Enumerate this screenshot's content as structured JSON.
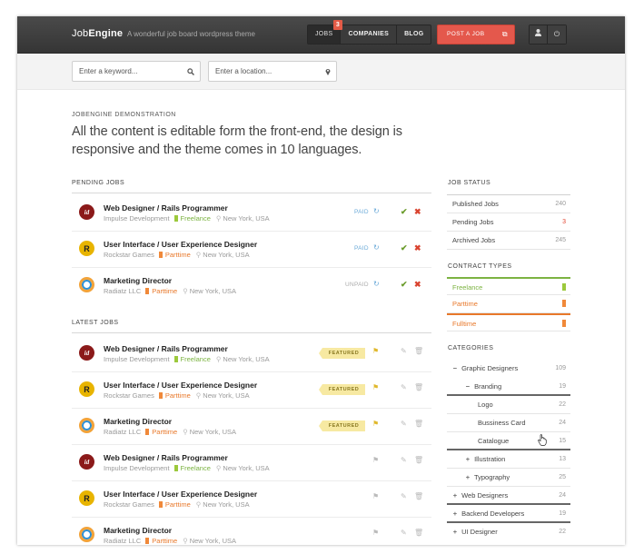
{
  "header": {
    "logo_light": "Job",
    "logo_bold": "Engine",
    "tagline": "A wonderful job board wordpress theme",
    "nav": [
      {
        "label": "JOBS",
        "badge": "3"
      },
      {
        "label": "COMPANIES"
      },
      {
        "label": "BLOG"
      }
    ],
    "post_job_label": "POST A JOB",
    "icons": [
      "user-icon",
      "power-icon"
    ]
  },
  "search": {
    "keyword_placeholder": "Enter a keyword...",
    "location_placeholder": "Enter a location..."
  },
  "intro": {
    "label": "JOBENGINE DEMONSTRATION",
    "headline": "All the content is editable form the front-end, the design is responsive and the theme comes in 10 languages."
  },
  "pending": {
    "title": "PENDING JOBS",
    "jobs": [
      {
        "title": "Web Designer / Rails Programmer",
        "company": "Impulse Development",
        "type": "Freelance",
        "location": "New York, USA",
        "status": "PAID"
      },
      {
        "title": "User Interface / User Experience Designer",
        "company": "Rockstar Games",
        "type": "Parttime",
        "location": "New York, USA",
        "status": "PAID"
      },
      {
        "title": "Marketing Director",
        "company": "Radiatz LLC",
        "type": "Parttime",
        "location": "New York, USA",
        "status": "UNPAID"
      }
    ]
  },
  "latest": {
    "title": "LATEST JOBS",
    "featured_label": "FEATURED",
    "jobs": [
      {
        "title": "Web Designer / Rails Programmer",
        "company": "Impulse Development",
        "type": "Freelance",
        "location": "New York, USA"
      },
      {
        "title": "User Interface / User Experience Designer",
        "company": "Rockstar Games",
        "type": "Parttime",
        "location": "New York, USA"
      },
      {
        "title": "Marketing Director",
        "company": "Radiatz LLC",
        "type": "Parttime",
        "location": "New York, USA"
      },
      {
        "title": "Web Designer / Rails Programmer",
        "company": "Impulse Development",
        "type": "Freelance",
        "location": "New York, USA"
      },
      {
        "title": "User Interface / User Experience Designer",
        "company": "Rockstar Games",
        "type": "Parttime",
        "location": "New York, USA"
      },
      {
        "title": "Marketing Director",
        "company": "Radiatz LLC",
        "type": "Parttime",
        "location": "New York, USA"
      }
    ]
  },
  "sidebar": {
    "status_title": "JOB STATUS",
    "status": [
      {
        "label": "Published Jobs",
        "count": "240"
      },
      {
        "label": "Pending Jobs",
        "count": "3"
      },
      {
        "label": "Archived Jobs",
        "count": "245"
      }
    ],
    "contract_title": "CONTRACT TYPES",
    "contracts": [
      {
        "label": "Freelance",
        "color": "#7cb342"
      },
      {
        "label": "Parttime",
        "color": "#e8782a"
      },
      {
        "label": "Fulltime",
        "color": "#e8782a"
      }
    ],
    "categories_title": "CATEGORIES",
    "categories": [
      {
        "label": "Graphic Designers",
        "count": "109",
        "toggle": "−"
      },
      {
        "label": "Branding",
        "count": "19",
        "toggle": "−"
      },
      {
        "label": "Logo",
        "count": "22",
        "toggle": ""
      },
      {
        "label": "Bussiness Card",
        "count": "24",
        "toggle": ""
      },
      {
        "label": "Catalogue",
        "count": "15",
        "toggle": ""
      },
      {
        "label": "Illustration",
        "count": "13",
        "toggle": "+"
      },
      {
        "label": "Typography",
        "count": "25",
        "toggle": "+"
      },
      {
        "label": "Web Designers",
        "count": "24",
        "toggle": "+"
      },
      {
        "label": "Backend Developers",
        "count": "19",
        "toggle": "+"
      },
      {
        "label": "UI Designer",
        "count": "22",
        "toggle": "+"
      }
    ]
  },
  "colors": {
    "accent_red": "#e4584c",
    "freelance_green": "#7cb342",
    "parttime_orange": "#e8782a"
  }
}
